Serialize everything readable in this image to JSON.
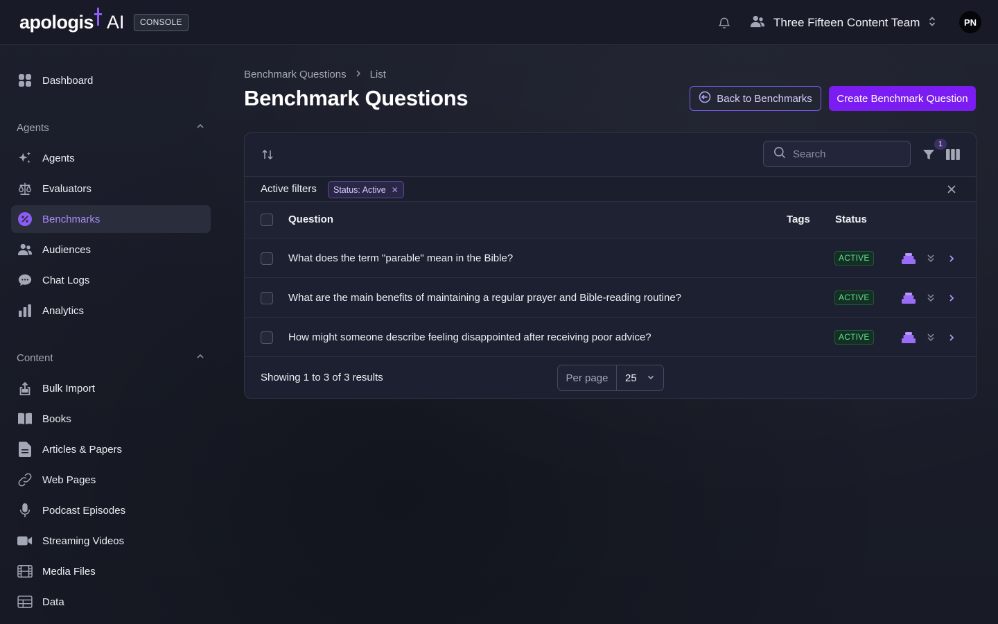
{
  "brand": {
    "logo_text": "apologist",
    "logo_ai": "AI",
    "console_label": "CONSOLE",
    "accent_color": "#8b5cf6"
  },
  "header": {
    "team_name": "Three Fifteen Content Team",
    "avatar_initials": "PN",
    "icons": [
      "bell-icon",
      "users-icon",
      "chevron-up-down-icon"
    ]
  },
  "sidebar": {
    "dashboard": {
      "label": "Dashboard",
      "icon": "dashboard-icon"
    },
    "agents_group": {
      "label": "Agents",
      "items": [
        {
          "label": "Agents",
          "icon": "sparkles-icon"
        },
        {
          "label": "Evaluators",
          "icon": "scale-icon"
        },
        {
          "label": "Benchmarks",
          "icon": "benchmark-icon",
          "active": true
        },
        {
          "label": "Audiences",
          "icon": "users-icon"
        },
        {
          "label": "Chat Logs",
          "icon": "chat-icon"
        },
        {
          "label": "Analytics",
          "icon": "bar-chart-icon"
        }
      ]
    },
    "content_group": {
      "label": "Content",
      "items": [
        {
          "label": "Bulk Import",
          "icon": "upload-icon"
        },
        {
          "label": "Books",
          "icon": "book-icon"
        },
        {
          "label": "Articles & Papers",
          "icon": "document-icon"
        },
        {
          "label": "Web Pages",
          "icon": "link-icon"
        },
        {
          "label": "Podcast Episodes",
          "icon": "microphone-icon"
        },
        {
          "label": "Streaming Videos",
          "icon": "video-icon"
        },
        {
          "label": "Media Files",
          "icon": "film-icon"
        },
        {
          "label": "Data",
          "icon": "table-icon"
        }
      ]
    }
  },
  "page": {
    "breadcrumb": [
      "Benchmark Questions",
      "List"
    ],
    "title": "Benchmark Questions",
    "back_button": "Back to Benchmarks",
    "create_button": "Create Benchmark Question"
  },
  "table": {
    "search_placeholder": "Search",
    "filter_count": "1",
    "active_filters_label": "Active filters",
    "active_filter_chip": "Status: Active",
    "columns": [
      "Question",
      "Tags",
      "Status"
    ],
    "rows": [
      {
        "question": "What does the term \"parable\" mean in the Bible?",
        "tags": "",
        "status": "ACTIVE"
      },
      {
        "question": "What are the main benefits of maintaining a regular prayer and Bible-reading routine?",
        "tags": "",
        "status": "ACTIVE"
      },
      {
        "question": "How might someone describe feeling disappointed after receiving poor advice?",
        "tags": "",
        "status": "ACTIVE"
      }
    ],
    "showing_text": "Showing 1 to 3 of 3 results",
    "per_page_label": "Per page",
    "per_page_value": "25"
  }
}
